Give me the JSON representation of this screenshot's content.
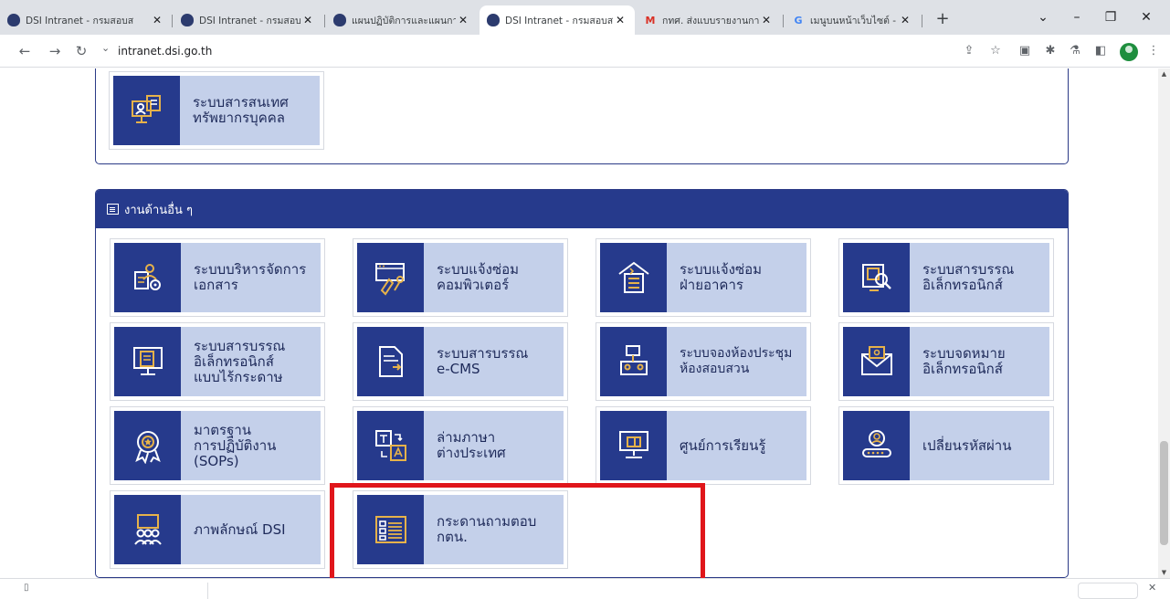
{
  "browser": {
    "tabs": [
      {
        "title": "DSI Intranet - กรมสอบส",
        "favicon": "dsi-shield-icon",
        "active": false
      },
      {
        "title": "DSI Intranet - กรมสอบส",
        "favicon": "dsi-shield-icon",
        "active": false
      },
      {
        "title": "แผนปฏิบัติการและแผนกา",
        "favicon": "dsi-shield-icon",
        "active": false
      },
      {
        "title": "DSI Intranet - กรมสอบส",
        "favicon": "dsi-shield-icon",
        "active": true
      },
      {
        "title": "กทศ. ส่งแบบรายงานการใ",
        "favicon": "gmail-icon",
        "active": false
      },
      {
        "title": "เมนูบนหน้าเว็บไซต์ - ค้นห",
        "favicon": "google-icon",
        "active": false
      }
    ],
    "url": "intranet.dsi.go.th"
  },
  "top_section": {
    "tiles": [
      {
        "label": "ระบบสารสนเทศ\nทรัพยากรบุคคล",
        "icon": "hr-info-system-icon"
      }
    ]
  },
  "main_section": {
    "title": "งานด้านอื่น ๆ",
    "tiles": [
      {
        "label": "ระบบบริหารจัดการ\nเอกสาร",
        "icon": "document-management-icon"
      },
      {
        "label": "ระบบแจ้งซ่อม\nคอมพิวเตอร์",
        "icon": "computer-repair-icon"
      },
      {
        "label": "ระบบแจ้งซ่อม\nฝ่ายอาคาร",
        "icon": "building-repair-icon"
      },
      {
        "label": "ระบบสารบรรณ\nอิเล็กทรอนิกส์",
        "icon": "e-saraban-icon"
      },
      {
        "label": "ระบบสารบรรณ\nอิเล็กทรอนิกส์\nแบบไร้กระดาษ",
        "icon": "paperless-saraban-icon"
      },
      {
        "label": "ระบบสารบรรณ\ne-CMS",
        "icon": "e-cms-icon"
      },
      {
        "label": "ระบบจองห้องประชุม\nห้องสอบสวน",
        "icon": "room-booking-icon"
      },
      {
        "label": "ระบบจดหมาย\nอิเล็กทรอนิกส์",
        "icon": "email-icon"
      },
      {
        "label": "มาตรฐาน\nการปฏิบัติงาน (SOPs)",
        "icon": "sop-award-icon"
      },
      {
        "label": "ล่ามภาษา\nต่างประเทศ",
        "icon": "translator-icon"
      },
      {
        "label": "ศูนย์การเรียนรู้",
        "icon": "learning-center-icon"
      },
      {
        "label": "เปลี่ยนรหัสผ่าน",
        "icon": "change-password-icon"
      },
      {
        "label": "ภาพลักษณ์ DSI",
        "icon": "dsi-image-icon"
      },
      {
        "label": "กระดานถามตอบ\nกตน.",
        "icon": "qa-board-icon"
      }
    ]
  },
  "colors": {
    "navy": "#263a8c",
    "tile_bg": "#c4d0ea",
    "icon_gold": "#e6b24a",
    "highlight": "#e0161b"
  }
}
